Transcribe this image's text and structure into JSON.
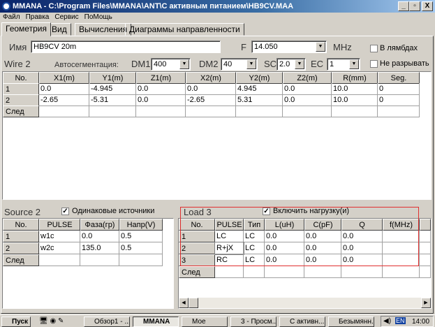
{
  "window": {
    "title": "MMANA - C:\\Program Files\\MMANA\\ANT\\С активным питанием\\HB9CV.MAA",
    "minimize": "_",
    "maximize": "▫",
    "close": "X"
  },
  "menu": [
    "Файл",
    "Правка",
    "Сервис",
    "ПоМощь"
  ],
  "tabs": [
    "Геометрия",
    "Вид",
    "Вычисления",
    "Диаграммы направленности"
  ],
  "name_label": "Имя",
  "name_value": "HB9CV 20m",
  "freq_label": "F",
  "freq_value": "14.050",
  "freq_unit": "MHz",
  "opt_lambda": "В лямбдах",
  "opt_nobreak": "Не разрывать",
  "wire_label": "Wire 2",
  "autoseg_label": "Автосегментация:",
  "dm1_label": "DM1",
  "dm1": "400",
  "dm2_label": "DM2",
  "dm2": "40",
  "sc_label": "SC",
  "sc": "2.0",
  "ec_label": "EC",
  "ec": "1",
  "wires": {
    "headers": [
      "No.",
      "X1(m)",
      "Y1(m)",
      "Z1(m)",
      "X2(m)",
      "Y2(m)",
      "Z2(m)",
      "R(mm)",
      "Seg."
    ],
    "rows": [
      [
        "1",
        "0.0",
        "-4.945",
        "0.0",
        "0.0",
        "4.945",
        "0.0",
        "10.0",
        "0"
      ],
      [
        "2",
        "-2.65",
        "-5.31",
        "0.0",
        "-2.65",
        "5.31",
        "0.0",
        "10.0",
        "0"
      ],
      [
        "След",
        "",
        "",
        "",
        "",
        "",
        "",
        "",
        ""
      ]
    ]
  },
  "source": {
    "label": "Source 2",
    "same_label": "Одинаковые источники",
    "same_checked": true,
    "headers": [
      "No.",
      "PULSE",
      "Фаза(гр)",
      "Напр(V)"
    ],
    "rows": [
      [
        "1",
        "w1c",
        "0.0",
        "0.5"
      ],
      [
        "2",
        "w2c",
        "135.0",
        "0.5"
      ],
      [
        "След",
        "",
        "",
        ""
      ]
    ]
  },
  "load": {
    "label": "Load  3",
    "enable_label": "Включить нагрузку(и)",
    "enable_checked": true,
    "headers": [
      "No.",
      "PULSE",
      "Тип",
      "L(uH)",
      "C(pF)",
      "Q",
      "f(MHz)",
      ""
    ],
    "rows": [
      [
        "1",
        "LC",
        "LC",
        "0.0",
        "0.0",
        "0.0",
        "",
        ""
      ],
      [
        "2",
        "R+jX",
        "LC",
        "0.0",
        "0.0",
        "0.0",
        "",
        ""
      ],
      [
        "3",
        "RC",
        "LC",
        "0.0",
        "0.0",
        "0.0",
        "",
        ""
      ],
      [
        "След",
        "",
        "",
        "",
        "",
        "",
        "",
        ""
      ]
    ],
    "highlight_color": "#e03030"
  },
  "taskbar": {
    "start": "Пуск",
    "tasks": [
      "Обзор1 - ...",
      "MMANA",
      "Мое",
      "3 - Просм...",
      "С активн...",
      "Безымянн..."
    ],
    "lang": "EN",
    "clock": "14:00"
  }
}
